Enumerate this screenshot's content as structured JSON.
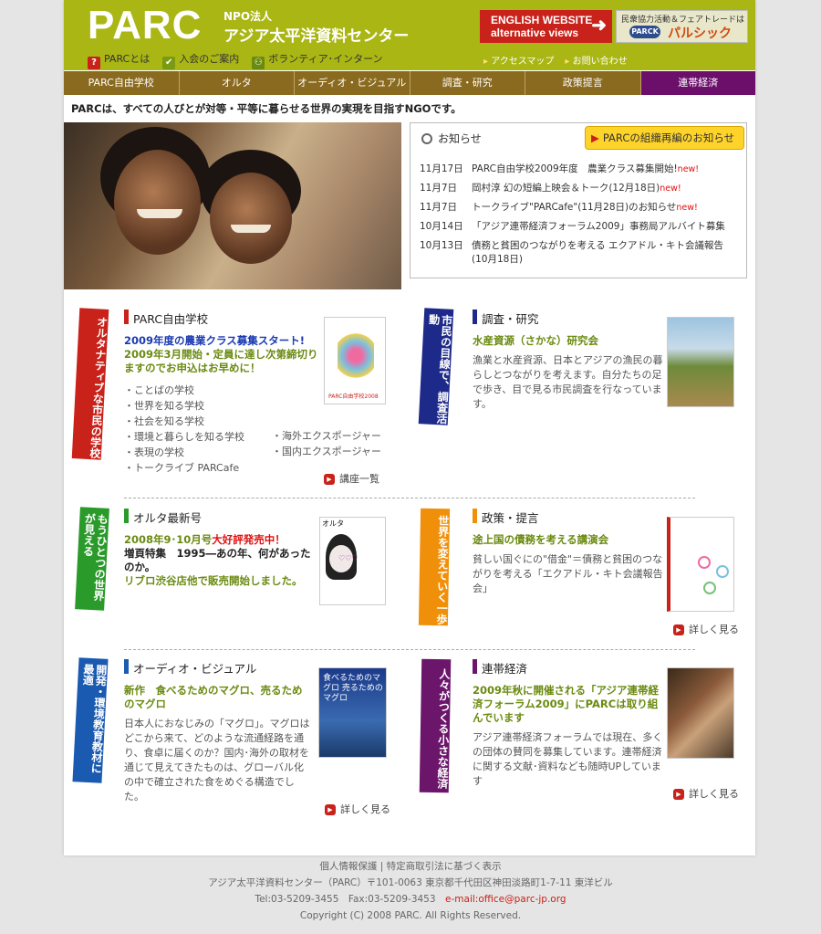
{
  "header": {
    "logo": "PARC",
    "npo": "NPO法人",
    "org_name": "アジア太平洋資料センター",
    "links": [
      {
        "label": "PARCとは",
        "icon": "question-icon",
        "color": "#c8221a"
      },
      {
        "label": "入会のご案内",
        "icon": "leaf-icon",
        "color": "#7a9a10"
      },
      {
        "label": "ボランティア･インターン",
        "icon": "people-icon",
        "color": "#6a8a10"
      }
    ],
    "english": "ENGLISH WEBSITE",
    "english2": "alternative views",
    "palsic_top": "民衆協力活動＆フェアトレードは",
    "palsic_pill": "PARCK",
    "palsic": "パルシック",
    "sublinks": [
      "アクセスマップ",
      "お問い合わせ"
    ]
  },
  "nav": [
    "PARC自由学校",
    "オルタ",
    "オーディオ・ビジュアル",
    "調査・研究",
    "政策提言",
    "連帯経済"
  ],
  "tagline": "PARCは、すべての人びとが対等・平等に暮らせる世界の実現を目指すNGOです。",
  "news": {
    "title": "お知らせ",
    "org_button": "PARCの組織再編のお知らせ",
    "new_label": "new!",
    "items": [
      {
        "date": "11月17日",
        "text": "PARC自由学校2009年度　農業クラス募集開始!",
        "new": "new!"
      },
      {
        "date": "11月7日",
        "text": "岡村淳 幻の短編上映会＆トーク(12月18日)",
        "new": "new!"
      },
      {
        "date": "11月7日",
        "text": "トークライブ\"PARCafe\"(11月28日)のお知らせ",
        "new": "new!"
      },
      {
        "date": "10月14日",
        "text": "「アジア連帯経済フォーラム2009」事務局アルバイト募集",
        "new": ""
      },
      {
        "date": "10月13日",
        "text": "債務と貧困のつながりを考える エクアドル・キト会議報告(10月18日)",
        "new": ""
      }
    ]
  },
  "sections": {
    "school": {
      "label": "オルタナティブな市民の学校",
      "title": "PARC自由学校",
      "lead1": "2009年度の農業クラス募集スタート!",
      "lead2": "2009年3月開始・定員に達し次第締切りますのでお申込はお早めに！",
      "items": [
        "・ことばの学校",
        "・世界を知る学校",
        "・社会を知る学校",
        "・環境と暮らしを知る学校",
        "・表現の学校",
        "・トークライブ PARCafe"
      ],
      "items2": [
        "・海外エクスポージャー",
        "・国内エクスポージャー"
      ],
      "more": "講座一覧",
      "thumb_caption": "PARC自由学校2008"
    },
    "research": {
      "label": "市民の目線で、調査活動",
      "title": "調査・研究",
      "lead": "水産資源（さかな）研究会",
      "body": "漁業と水産資源、日本とアジアの漁民の暮らしとつながりを考えます。自分たちの足で歩き、目で見る市民調査を行なっています。"
    },
    "alter": {
      "label": "もうひとつの世界が見える",
      "title": "オルタ最新号",
      "lead_a": "2008年9･10月号",
      "lead_b": "大好評発売中！",
      "lead_c": "増頁特集　1995―あの年、何があったのか。",
      "lead_d": "リブロ渋谷店他で販売開始しました。",
      "thumb_caption": "オルタ"
    },
    "policy": {
      "label": "世界を変えていく一歩",
      "title": "政策・提言",
      "lead": "途上国の債務を考える講演会",
      "body": "貧しい国ぐにの\"借金\"＝債務と貧困のつながりを考える「エクアドル・キト会議報告会」",
      "more": "詳しく見る"
    },
    "av": {
      "label": "開発・環境教育教材に最適",
      "title": "オーディオ・ビジュアル",
      "lead": "新作　食べるためのマグロ、売るためのマグロ",
      "body": "日本人におなじみの「マグロ」。マグロはどこから来て、どのような流通経路を通り、食卓に届くのか？国内･海外の取材を通じて見えてきたものは、グローバル化の中で確立された食をめぐる構造でした。",
      "more": "詳しく見る",
      "thumb_caption": "食べるためのマグロ 売るためのマグロ"
    },
    "solidarity": {
      "label": "人々がつくる小さな経済",
      "title": "連帯経済",
      "lead": "2009年秋に開催される「アジア連帯経済フォーラム2009」にPARCは取り組んでいます",
      "body": "アジア連帯経済フォーラムでは現在、多くの団体の賛同を募集しています。連帯経済に関する文献･資料なども随時UPしています",
      "more": "詳しく見る"
    }
  },
  "footer": {
    "line1": "個人情報保護 | 特定商取引法に基づく表示",
    "line2": "アジア太平洋資料センター（PARC）〒101-0063 東京都千代田区神田淡路町1-7-11 東洋ビル",
    "tel": "Tel:03-5209-3455　Fax:03-5209-3453",
    "mail": "e-mail:office@parc-jp.org",
    "copy": "Copyright (C) 2008 PARC. All Rights Reserved."
  },
  "colors": {
    "green": "#aab614",
    "school": "#c8221a",
    "research": "#1e2a8a",
    "alter": "#2a9a2a",
    "policy": "#f0900a",
    "av": "#1a5ab0",
    "solidarity": "#6b166b"
  }
}
